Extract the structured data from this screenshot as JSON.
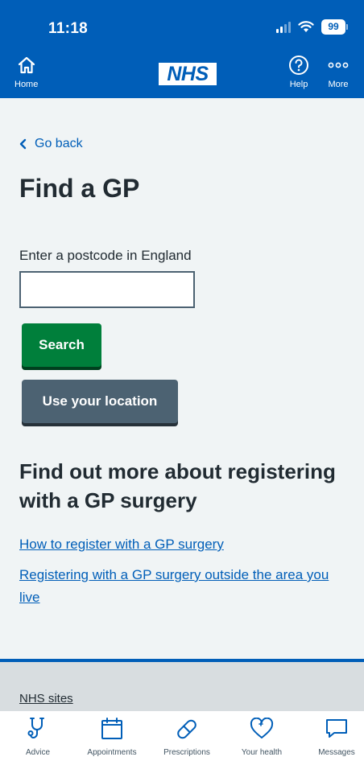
{
  "status_bar": {
    "time": "11:18",
    "battery": "99"
  },
  "header": {
    "home_label": "Home",
    "logo_text": "NHS",
    "help_label": "Help",
    "more_label": "More",
    "brand_color": "#005eb8"
  },
  "main": {
    "back_label": "Go back",
    "title": "Find a GP",
    "postcode_label": "Enter a postcode in England",
    "postcode_value": "",
    "search_button": "Search",
    "location_button": "Use your location",
    "more_heading": "Find out more about registering with a GP surgery",
    "links": [
      "How to register with a GP surgery",
      "Registering with a GP surgery outside the area you live"
    ]
  },
  "footer": {
    "nhs_sites_label": "NHS sites"
  },
  "tabbar": {
    "items": [
      {
        "label": "Advice",
        "icon": "stethoscope-icon"
      },
      {
        "label": "Appointments",
        "icon": "calendar-icon"
      },
      {
        "label": "Prescriptions",
        "icon": "pill-icon"
      },
      {
        "label": "Your health",
        "icon": "heart-icon"
      },
      {
        "label": "Messages",
        "icon": "message-icon"
      }
    ]
  },
  "colors": {
    "accent": "#005eb8",
    "search_button": "#007f3b",
    "location_button": "#4c6272",
    "background": "#f0f4f5"
  }
}
